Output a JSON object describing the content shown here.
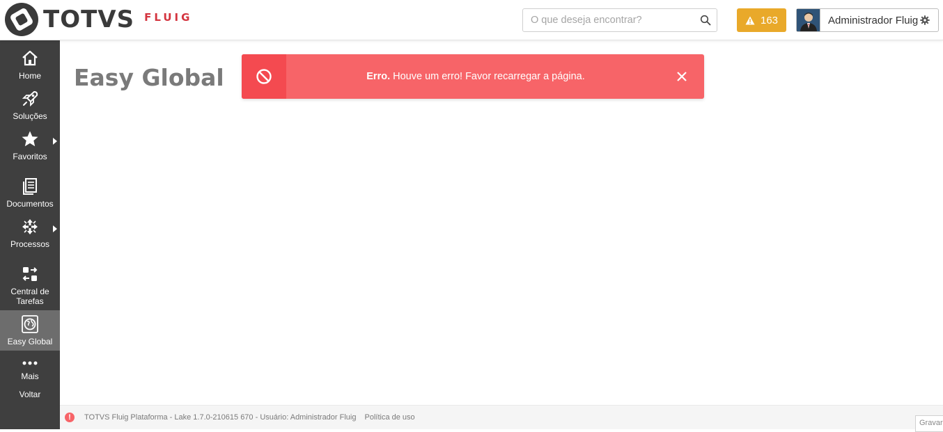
{
  "header": {
    "logo_text": "TOTVS",
    "logo_sub": "FLUIG",
    "search_placeholder": "O que deseja encontrar?",
    "alerts_count": "163",
    "user_name": "Administrador Fluig"
  },
  "sidebar": {
    "items": [
      {
        "label": "Home",
        "icon": "home-icon"
      },
      {
        "label": "Soluções",
        "icon": "rocket-icon"
      },
      {
        "label": "Favoritos",
        "icon": "star-icon"
      },
      {
        "label": "Documentos",
        "icon": "documents-icon"
      },
      {
        "label": "Processos",
        "icon": "processes-icon"
      },
      {
        "label": "Central de Tarefas",
        "icon": "tasks-icon"
      },
      {
        "label": "Easy Global",
        "icon": "globe-icon"
      },
      {
        "label": "Mais",
        "icon": "more-icon"
      },
      {
        "label": "Voltar"
      }
    ]
  },
  "main": {
    "title": "Easy Global"
  },
  "toast": {
    "strong": "Erro.",
    "message": " Houve um erro! Favor recarregar a página."
  },
  "footer": {
    "text": "TOTVS Fluig Plataforma - Lake 1.7.0-210615 670 - Usuário: Administrador Fluig",
    "policy_link": "Política de uso",
    "save_label": "Gravar"
  },
  "colors": {
    "sidebar_bg": "#3f3f3f",
    "active_item": "#6d6d6d",
    "alert_bg": "#e9a92a",
    "error_bg": "#f76468",
    "error_icon_bg": "#f44a50",
    "brand_red": "#d4343f"
  }
}
